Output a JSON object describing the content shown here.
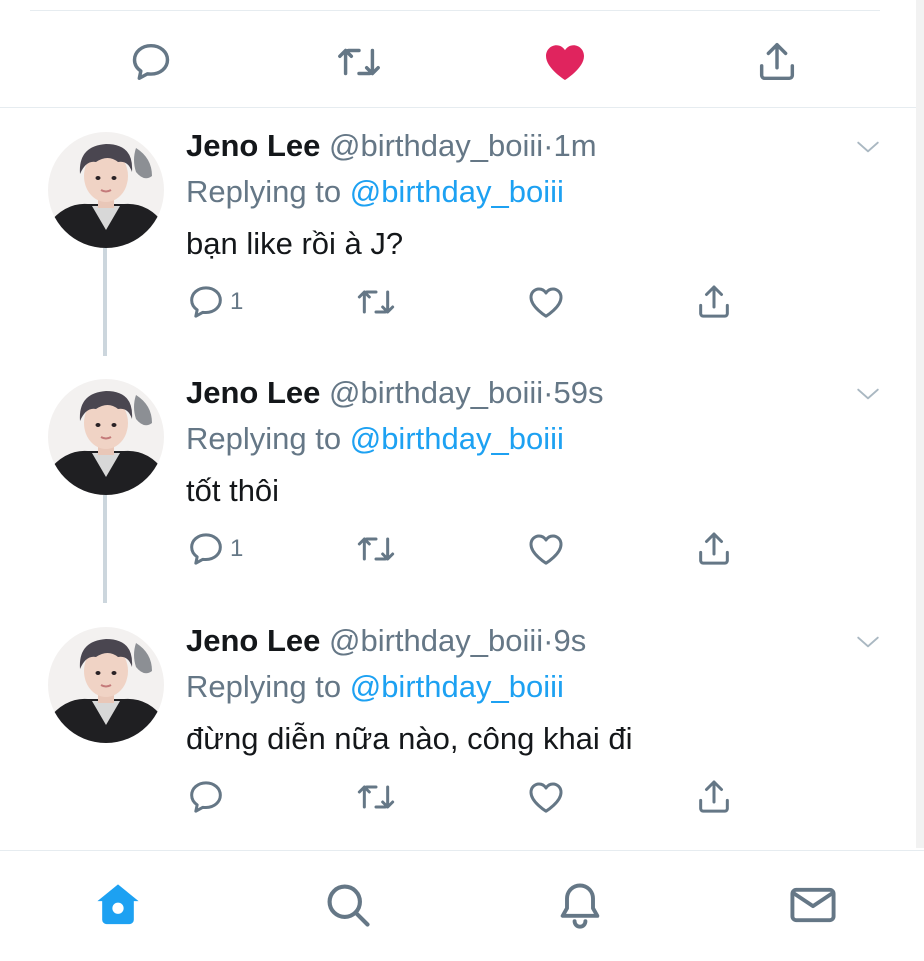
{
  "colors": {
    "accent": "#1da1f2",
    "like": "#e0245e",
    "text": "#14171a",
    "meta": "#657786",
    "icon": "#657786"
  },
  "top_toolbar": {
    "icons": [
      "reply-icon",
      "retweet-icon",
      "liked-heart-icon",
      "share-icon"
    ]
  },
  "tweets": [
    {
      "name": "Jeno Lee",
      "handle": "@birthday_boiii",
      "sep": "·",
      "time": "1m",
      "replying_prefix": "Replying to",
      "replying_to": "@birthday_boiii",
      "text": "bạn like rồi à J?",
      "reply_count": "1"
    },
    {
      "name": "Jeno Lee",
      "handle": "@birthday_boiii",
      "sep": "·",
      "time": "59s",
      "replying_prefix": "Replying to",
      "replying_to": "@birthday_boiii",
      "text": "tốt thôi",
      "reply_count": "1"
    },
    {
      "name": "Jeno Lee",
      "handle": "@birthday_boiii",
      "sep": "·",
      "time": "9s",
      "replying_prefix": "Replying to",
      "replying_to": "@birthday_boiii",
      "text": "đừng diễn nữa nào, công khai đi",
      "reply_count": ""
    }
  ],
  "bottom_nav": {
    "items": [
      "home-icon",
      "search-icon",
      "notifications-bell-icon",
      "messages-envelope-icon"
    ],
    "active": "home-icon"
  }
}
